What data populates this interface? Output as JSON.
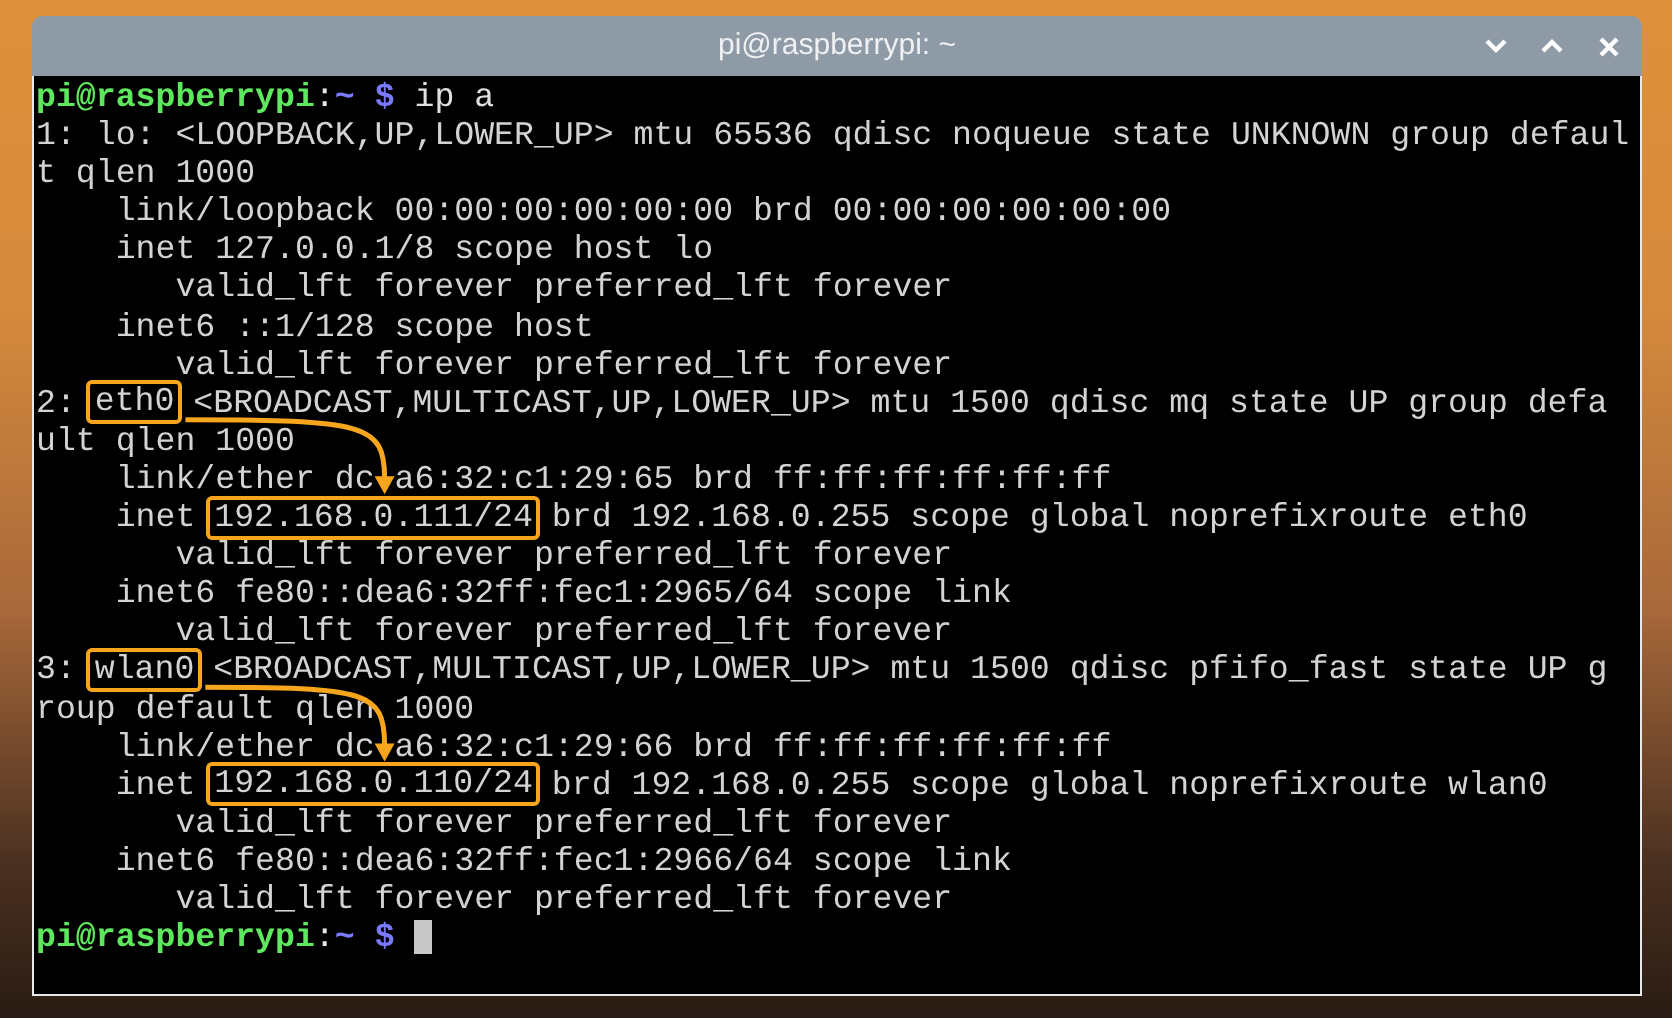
{
  "window": {
    "title": "pi@raspberrypi: ~"
  },
  "terminal": {
    "lines": [
      {
        "kind": "prompt",
        "user_host": "pi@raspberrypi",
        "separator": ":",
        "path": "~",
        "symbol": " $ ",
        "command": "ip a",
        "cursor": false
      },
      {
        "kind": "output",
        "segments": [
          {
            "text": "1: lo: <LOOPBACK,UP,LOWER_UP> mtu 65536 qdisc noqueue state UNKNOWN group defaul",
            "boxed": false
          }
        ]
      },
      {
        "kind": "output",
        "segments": [
          {
            "text": "t qlen 1000",
            "boxed": false
          }
        ]
      },
      {
        "kind": "output",
        "segments": [
          {
            "text": "    link/loopback 00:00:00:00:00:00 brd 00:00:00:00:00:00",
            "boxed": false
          }
        ]
      },
      {
        "kind": "output",
        "segments": [
          {
            "text": "    inet 127.0.0.1/8 scope host lo",
            "boxed": false
          }
        ]
      },
      {
        "kind": "output",
        "segments": [
          {
            "text": "       valid_lft forever preferred_lft forever",
            "boxed": false
          }
        ]
      },
      {
        "kind": "output",
        "segments": [
          {
            "text": "    inet6 ::1/128 scope host",
            "boxed": false
          }
        ]
      },
      {
        "kind": "output",
        "segments": [
          {
            "text": "       valid_lft forever preferred_lft forever",
            "boxed": false
          }
        ]
      },
      {
        "kind": "output",
        "segments": [
          {
            "text": "2: ",
            "boxed": false
          },
          {
            "text": "eth0",
            "boxed": true
          },
          {
            "text": " <BROADCAST,MULTICAST,UP,LOWER_UP> mtu 1500 qdisc mq state UP group defa",
            "boxed": false
          }
        ]
      },
      {
        "kind": "output",
        "segments": [
          {
            "text": "ult qlen 1000",
            "boxed": false
          }
        ]
      },
      {
        "kind": "output",
        "segments": [
          {
            "text": "    link/ether dc:a6:32:c1:29:65 brd ff:ff:ff:ff:ff:ff",
            "boxed": false
          }
        ]
      },
      {
        "kind": "output",
        "segments": [
          {
            "text": "    inet ",
            "boxed": false
          },
          {
            "text": "192.168.0.111/24",
            "boxed": true
          },
          {
            "text": " brd 192.168.0.255 scope global noprefixroute eth0",
            "boxed": false
          }
        ]
      },
      {
        "kind": "output",
        "segments": [
          {
            "text": "       valid_lft forever preferred_lft forever",
            "boxed": false
          }
        ]
      },
      {
        "kind": "output",
        "segments": [
          {
            "text": "    inet6 fe80::dea6:32ff:fec1:2965/64 scope link",
            "boxed": false
          }
        ]
      },
      {
        "kind": "output",
        "segments": [
          {
            "text": "       valid_lft forever preferred_lft forever",
            "boxed": false
          }
        ]
      },
      {
        "kind": "output",
        "segments": [
          {
            "text": "3: ",
            "boxed": false
          },
          {
            "text": "wlan0",
            "boxed": true
          },
          {
            "text": " <BROADCAST,MULTICAST,UP,LOWER_UP> mtu 1500 qdisc pfifo_fast state UP g",
            "boxed": false
          }
        ]
      },
      {
        "kind": "output",
        "segments": [
          {
            "text": "roup default qlen 1000",
            "boxed": false
          }
        ]
      },
      {
        "kind": "output",
        "segments": [
          {
            "text": "    link/ether dc:a6:32:c1:29:66 brd ff:ff:ff:ff:ff:ff",
            "boxed": false
          }
        ]
      },
      {
        "kind": "output",
        "segments": [
          {
            "text": "    inet ",
            "boxed": false
          },
          {
            "text": "192.168.0.110/24",
            "boxed": true
          },
          {
            "text": " brd 192.168.0.255 scope global noprefixroute wlan0",
            "boxed": false
          }
        ]
      },
      {
        "kind": "output",
        "segments": [
          {
            "text": "       valid_lft forever preferred_lft forever",
            "boxed": false
          }
        ]
      },
      {
        "kind": "output",
        "segments": [
          {
            "text": "    inet6 fe80::dea6:32ff:fec1:2966/64 scope link",
            "boxed": false
          }
        ]
      },
      {
        "kind": "output",
        "segments": [
          {
            "text": "       valid_lft forever preferred_lft forever",
            "boxed": false
          }
        ]
      },
      {
        "kind": "prompt",
        "user_host": "pi@raspberrypi",
        "separator": ":",
        "path": "~",
        "symbol": " $ ",
        "cursor": true
      }
    ]
  }
}
